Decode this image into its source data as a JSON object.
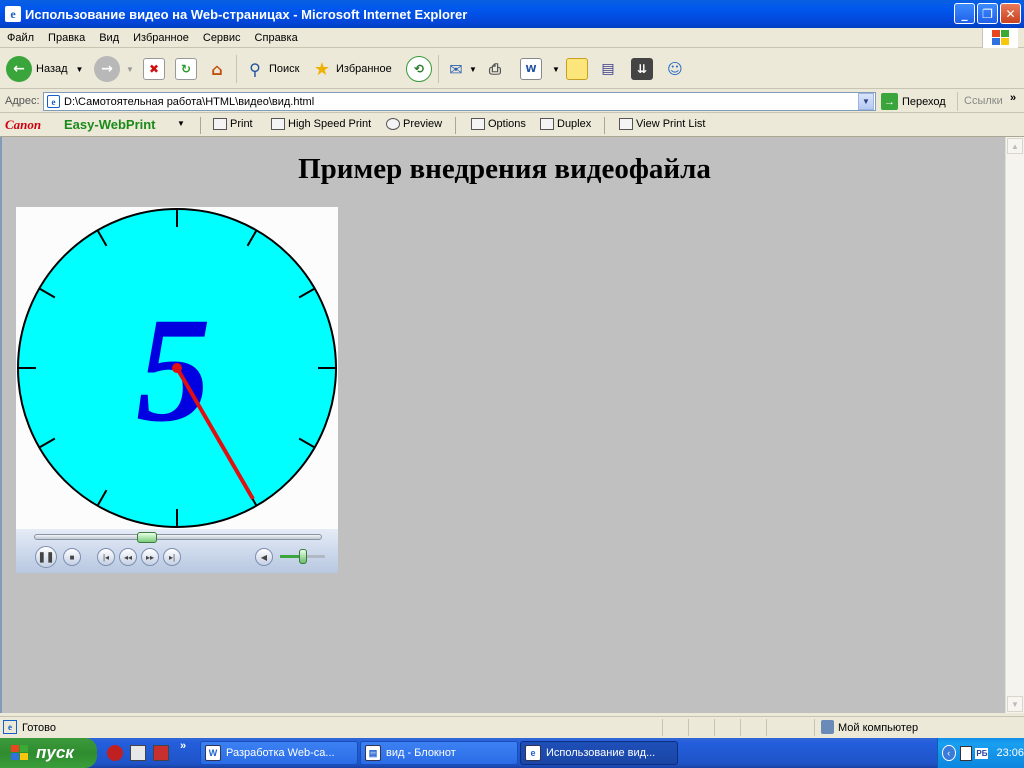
{
  "window": {
    "title": "Использование видео на Web-страницах - Microsoft Internet Explorer"
  },
  "menu": [
    "Файл",
    "Правка",
    "Вид",
    "Избранное",
    "Сервис",
    "Справка"
  ],
  "toolbar": {
    "back_label": "Назад",
    "search_label": "Поиск",
    "favorites_label": "Избранное"
  },
  "address": {
    "label": "Адрес:",
    "url": "D:\\Самотоятельная работа\\HTML\\видео\\вид.html",
    "go_label": "Переход",
    "links_label": "Ссылки"
  },
  "canon_bar": {
    "brand": "Canon",
    "product": "Easy-WebPrint",
    "print": "Print",
    "high_speed": "High Speed Print",
    "preview": "Preview",
    "options": "Options",
    "duplex": "Duplex",
    "view_list": "View Print List"
  },
  "page": {
    "heading": "Пример внедрения видеофайла",
    "clock_digit": "5"
  },
  "player": {
    "seek_position": 0.39,
    "volume_level": 0.5
  },
  "status": {
    "text": "Готово",
    "zone": "Мой компьютер"
  },
  "taskbar": {
    "start_label": "пуск",
    "tasks": [
      {
        "label": "Разработка Web-са..."
      },
      {
        "label": "вид - Блокнот"
      },
      {
        "label": "Использование вид..."
      }
    ],
    "lang": "РБ",
    "time": "23:06"
  },
  "colors": {
    "clock_face": "#00FFFF",
    "digit": "#0000E0",
    "hand": "#E01010",
    "page_bg": "#C0C0C0"
  }
}
